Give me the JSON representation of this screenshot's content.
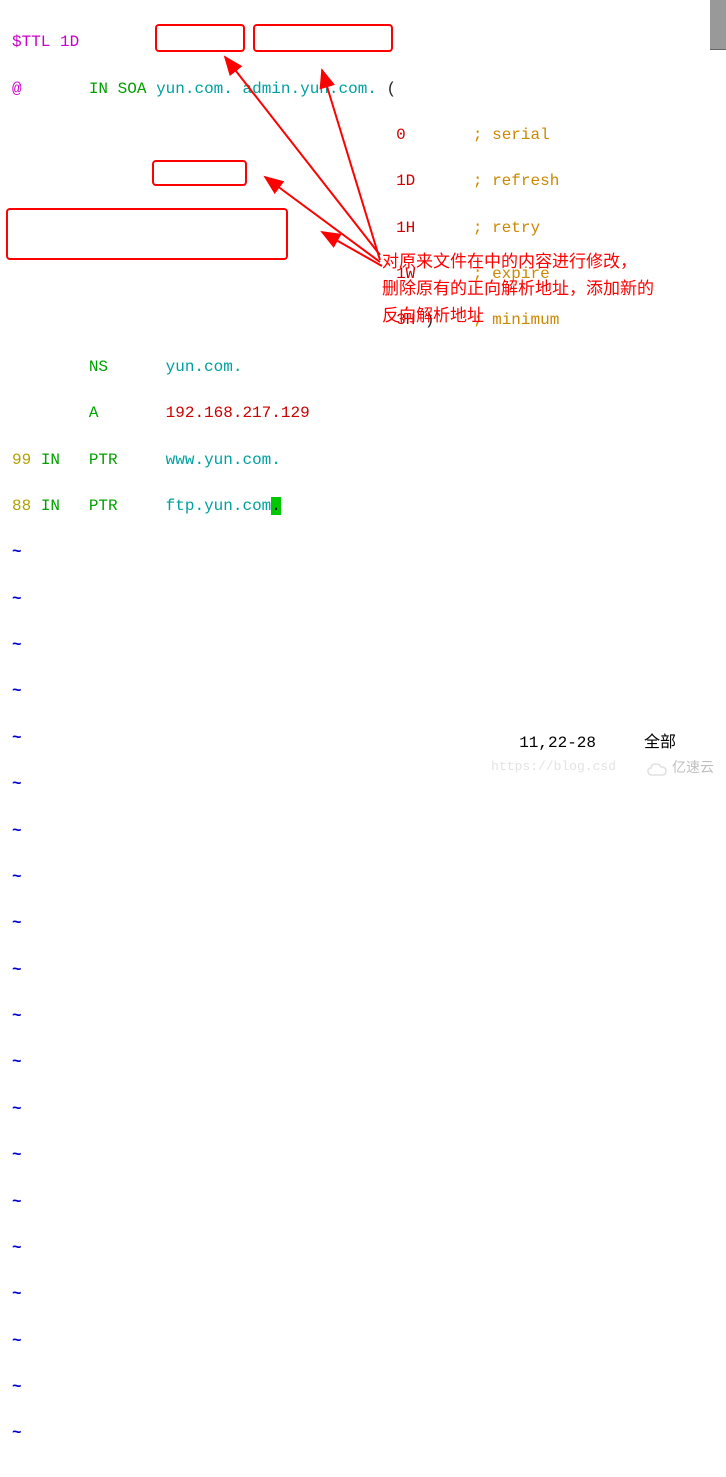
{
  "zone": {
    "ttl_directive": "$TTL",
    "ttl_value": "1D",
    "origin_at": "@",
    "in": "IN",
    "soa": "SOA",
    "mname": "yun.com.",
    "rname": "admin.yun.com.",
    "paren_open": "(",
    "paren_close": ")",
    "serial_val": "0",
    "serial_c": "; serial",
    "refresh_val": "1D",
    "refresh_c": "; refresh",
    "retry_val": "1H",
    "retry_c": "; retry",
    "expire_val": "1W",
    "expire_c": "; expire",
    "minimum_val": "3H",
    "minimum_c": "; minimum",
    "ns": "NS",
    "ns_val": "yun.com.",
    "a": "A",
    "a_val": "192.168.217.129",
    "rec99_n": "99",
    "rec99_in": "IN",
    "rec99_ptr": "PTR",
    "rec99_val": "www.yun.com.",
    "rec88_n": "88",
    "rec88_in": "IN",
    "rec88_ptr": "PTR",
    "rec88_val_part": "ftp.yun.com",
    "rec88_cursor": "."
  },
  "tilde": "~",
  "status": {
    "position": "11,22-28",
    "mode": "全部"
  },
  "annotation": {
    "line1": "对原来文件在中的内容进行修改，",
    "line2": "删除原有的正向解析地址，添加新的",
    "line3": "反向解析地址"
  },
  "watermark": {
    "brand": "亿速云",
    "url": "https://blog.csd"
  },
  "colors": {
    "annotation": "#ff0000"
  }
}
